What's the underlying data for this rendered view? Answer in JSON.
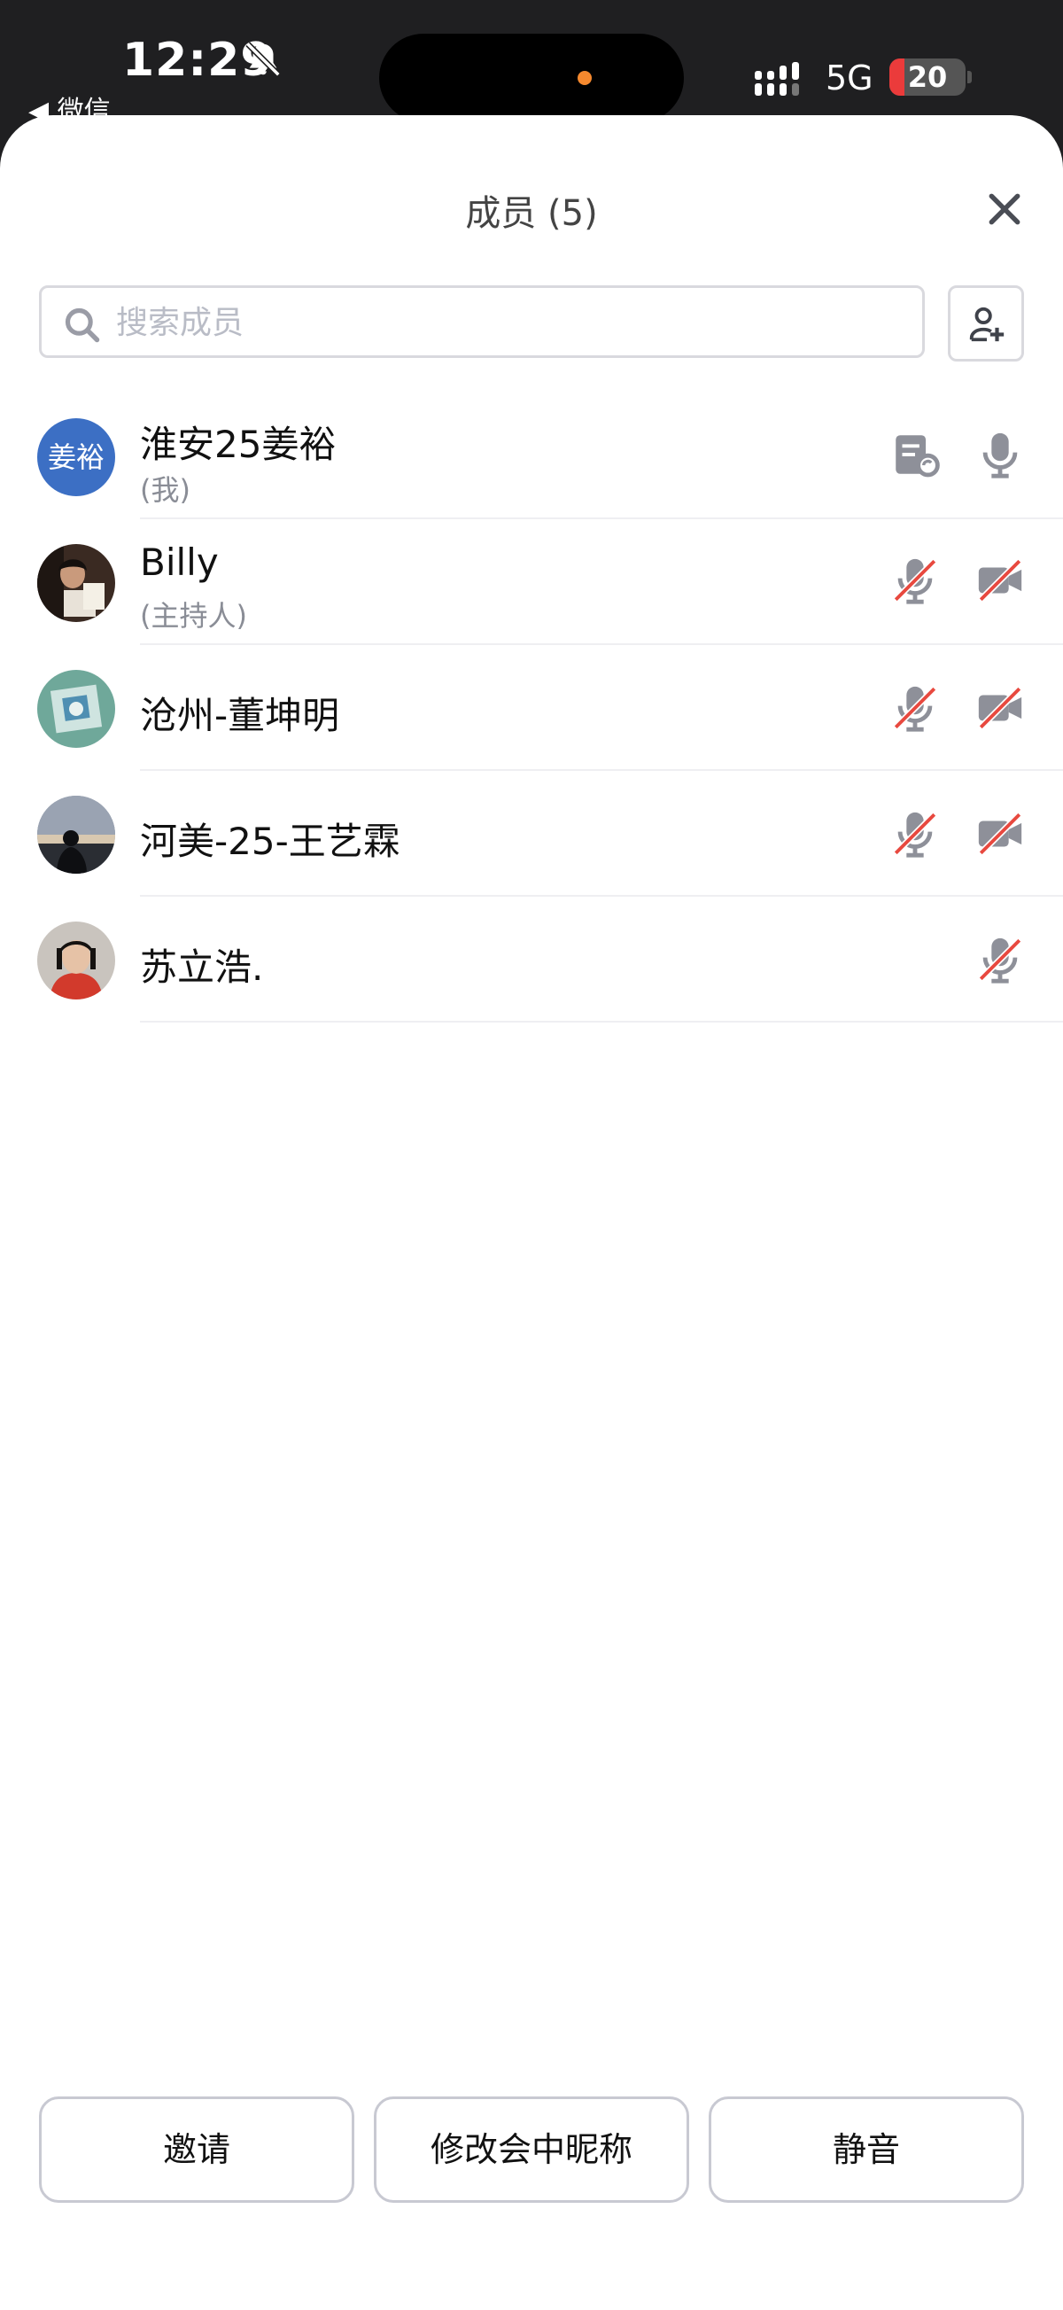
{
  "status": {
    "time": "12:29",
    "back_label": "◀ 微信",
    "network": "5G",
    "battery": "20",
    "battery_level": 0.2
  },
  "panel": {
    "title": "成员 (5)",
    "search_placeholder": "搜索成员"
  },
  "members": [
    {
      "name": "淮安25姜裕",
      "role": "(我)",
      "avatar_text": "姜裕"
    },
    {
      "name": "Billy",
      "role": "(主持人)"
    },
    {
      "name": "沧州-董坤明"
    },
    {
      "name": "河美-25-王艺霖"
    },
    {
      "name": "苏立浩."
    }
  ],
  "buttons": {
    "invite": "邀请",
    "rename": "修改会中昵称",
    "mute": "静音"
  },
  "colors": {
    "accent_avatar": "#3c6fc4",
    "muted_slash": "#e8493f",
    "icon_gray": "#8e9099"
  }
}
